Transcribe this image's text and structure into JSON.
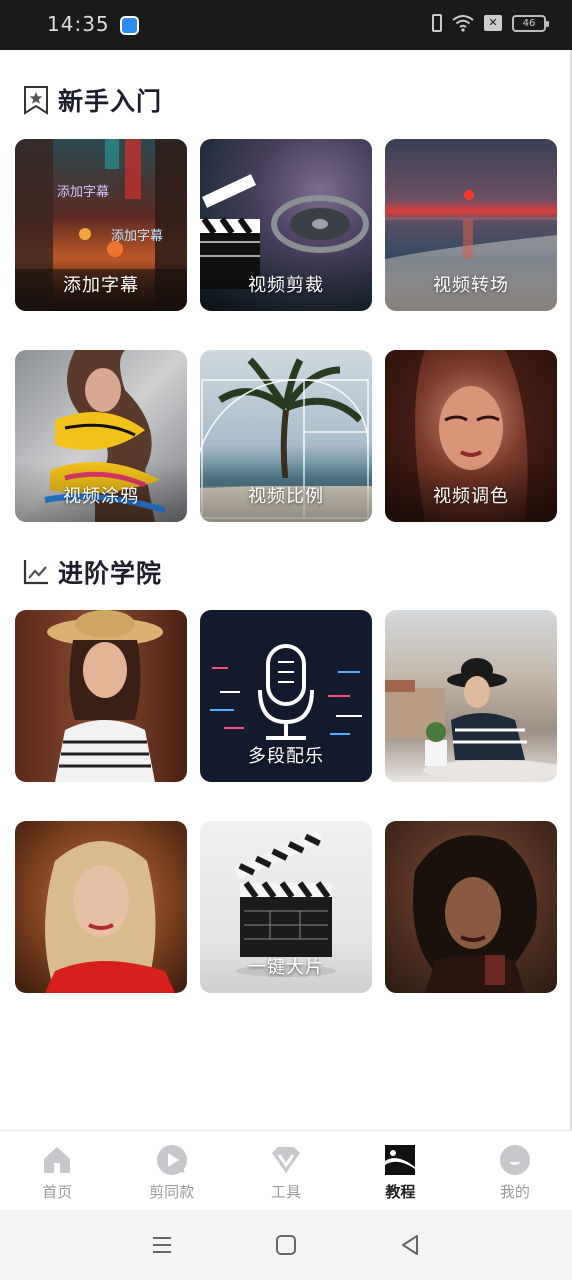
{
  "status_bar": {
    "time": "14:35",
    "battery": "46"
  },
  "sections": [
    {
      "title": "新手入门",
      "icon": "bookmark-star-icon",
      "tiles": [
        {
          "label": "添加字幕",
          "art": "street-night"
        },
        {
          "label": "视频剪裁",
          "art": "film-reel-clapper"
        },
        {
          "label": "视频转场",
          "art": "sunset-beach"
        },
        {
          "label": "视频涂鸦",
          "art": "graffiti-portrait"
        },
        {
          "label": "视频比例",
          "art": "palm-tree-golden-ratio"
        },
        {
          "label": "视频调色",
          "art": "portrait-red-light"
        }
      ]
    },
    {
      "title": "进阶学院",
      "icon": "trend-chart-icon",
      "tiles": [
        {
          "label": "",
          "art": "hat-girl"
        },
        {
          "label": "多段配乐",
          "art": "microphone"
        },
        {
          "label": "",
          "art": "city-girl"
        },
        {
          "label": "",
          "art": "blonde-portrait"
        },
        {
          "label": "一键大片",
          "art": "clapperboard"
        },
        {
          "label": "",
          "art": "curly-portrait"
        }
      ]
    }
  ],
  "tile_overlay_text": {
    "caption_top": "添加字幕",
    "caption_bottom": "添加字幕"
  },
  "bottom_nav": [
    {
      "label": "首页",
      "icon": "home-icon",
      "active": false
    },
    {
      "label": "剪同款",
      "icon": "play-bubble-icon",
      "active": false
    },
    {
      "label": "工具",
      "icon": "diamond-icon",
      "active": false
    },
    {
      "label": "教程",
      "icon": "picture-icon",
      "active": true
    },
    {
      "label": "我的",
      "icon": "profile-icon",
      "active": false
    }
  ],
  "colors": {
    "title": "#1c1f2b",
    "nav_inactive": "#9a9aa0",
    "nav_active": "#222222",
    "status_bar_bg": "#1a1a1a"
  }
}
